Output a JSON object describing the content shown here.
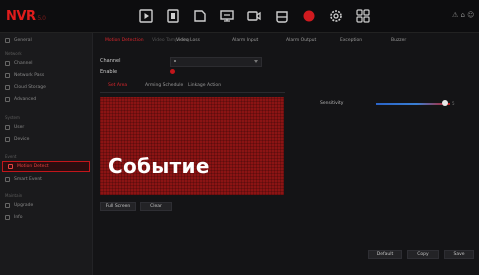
{
  "app": {
    "logo": "NVR",
    "version": "5.0"
  },
  "topbar": {
    "icons": [
      {
        "name": "playback-icon"
      },
      {
        "name": "file-icon"
      },
      {
        "name": "folder-icon"
      },
      {
        "name": "monitor-icon"
      },
      {
        "name": "camera-icon"
      },
      {
        "name": "storage-icon"
      },
      {
        "name": "event-icon"
      },
      {
        "name": "settings-icon"
      },
      {
        "name": "grid-icon"
      }
    ],
    "right_status": "⚠ ⌂ ☺"
  },
  "sidebar": {
    "groups": [
      {
        "head": "",
        "items": [
          {
            "label": "General"
          }
        ]
      },
      {
        "head": "Network",
        "items": [
          {
            "label": "Channel"
          },
          {
            "label": "Network Pass"
          },
          {
            "label": "Cloud Storage"
          },
          {
            "label": "Advanced"
          }
        ]
      },
      {
        "head": "System",
        "items": [
          {
            "label": "User"
          },
          {
            "label": "Device"
          }
        ]
      },
      {
        "head": "Event",
        "items": [
          {
            "label": "Motion Detect"
          },
          {
            "label": "Smart Event"
          }
        ]
      },
      {
        "head": "Maintain",
        "items": [
          {
            "label": "Upgrade"
          },
          {
            "label": "Info"
          }
        ]
      }
    ]
  },
  "tabs": [
    {
      "label": "Motion Detection",
      "state": "active"
    },
    {
      "label": "Video Tampering",
      "state": "dim"
    },
    {
      "label": "Video Loss",
      "state": ""
    },
    {
      "label": "Alarm Input",
      "state": ""
    },
    {
      "label": "Alarm Output",
      "state": ""
    },
    {
      "label": "Exception",
      "state": ""
    },
    {
      "label": "Buzzer",
      "state": ""
    }
  ],
  "form": {
    "channel_label": "Channel",
    "enable_label": "Enable",
    "channel_value": ""
  },
  "subtabs": [
    {
      "label": "Set Area",
      "state": "active"
    },
    {
      "label": "Arming Schedule",
      "state": ""
    },
    {
      "label": "Linkage Action",
      "state": ""
    }
  ],
  "overlay": {
    "text": "Событие"
  },
  "sensitivity": {
    "label": "Sensitivity",
    "value": 0.93,
    "value_text": "5"
  },
  "area_buttons": {
    "full_screen": "Full Screen",
    "clear": "Clear"
  },
  "footer": {
    "default": "Default",
    "copy": "Copy",
    "save": "Save"
  },
  "colors": {
    "accent": "#c2161b",
    "grid": "#8b1414",
    "bg": "#141416"
  }
}
